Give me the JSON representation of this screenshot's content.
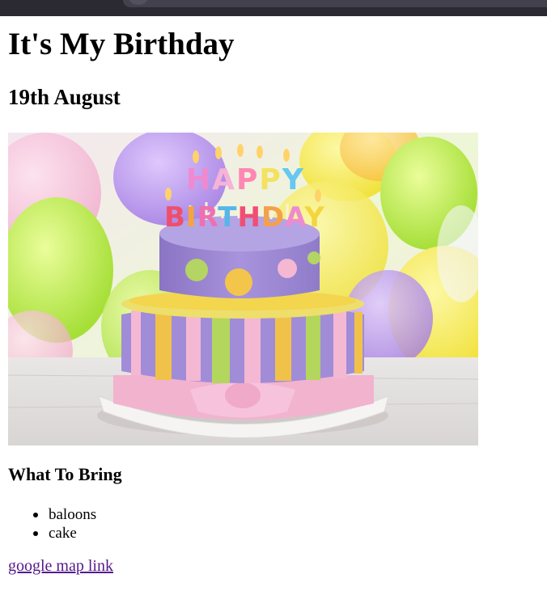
{
  "page": {
    "title": "It's My Birthday",
    "date": "19th August"
  },
  "image": {
    "subject": "birthday-cake-photo",
    "candle_letters_top": "HAPPY",
    "candle_letters_bottom": "BIRTHDAY"
  },
  "bring": {
    "heading": "What To Bring",
    "items": [
      "baloons",
      "cake"
    ]
  },
  "link": {
    "label": "google map link"
  },
  "colors": {
    "browser_chrome": "#2b2a33",
    "visited_link": "#551a8b",
    "cake_purple": "#9b86d4",
    "cake_pink": "#f3b4cf"
  }
}
